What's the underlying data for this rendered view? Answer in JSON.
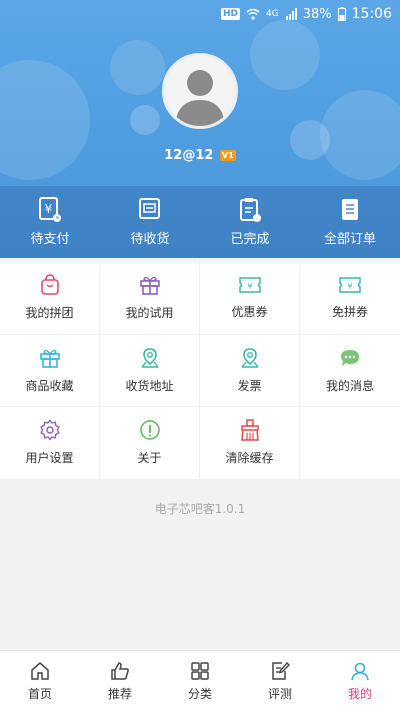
{
  "status_bar": {
    "hd": "HD",
    "network": "4G",
    "battery": "38%",
    "time": "15:06"
  },
  "profile": {
    "username": "12@12",
    "level_badge": "V1",
    "avatar_icon": "person-avatar-icon"
  },
  "orders": [
    {
      "label": "待支付",
      "icon": "pending-payment-icon"
    },
    {
      "label": "待收货",
      "icon": "pending-receipt-icon"
    },
    {
      "label": "已完成",
      "icon": "completed-order-icon"
    },
    {
      "label": "全部订单",
      "icon": "all-orders-icon"
    }
  ],
  "menu": [
    {
      "label": "我的拼团",
      "icon": "shopping-bag-icon",
      "color": "#e74c6f"
    },
    {
      "label": "我的试用",
      "icon": "gift-icon",
      "color": "#8e5ec9"
    },
    {
      "label": "优惠券",
      "icon": "ticket-icon",
      "color": "#3bb7a8"
    },
    {
      "label": "免拼券",
      "icon": "ticket-icon",
      "color": "#3bb7a8"
    },
    {
      "label": "商品收藏",
      "icon": "gift-icon",
      "color": "#3cb6d8"
    },
    {
      "label": "收货地址",
      "icon": "map-pin-icon",
      "color": "#3bb7a8"
    },
    {
      "label": "发票",
      "icon": "map-pin-icon",
      "color": "#3bb7a8"
    },
    {
      "label": "我的消息",
      "icon": "chat-bubble-icon",
      "color": "#5cb85c"
    },
    {
      "label": "用户设置",
      "icon": "gear-icon",
      "color": "#8e5ec9"
    },
    {
      "label": "关于",
      "icon": "info-icon",
      "color": "#5cb85c"
    },
    {
      "label": "清除缓存",
      "icon": "broom-icon",
      "color": "#e74c4c"
    }
  ],
  "version": "电子芯吧客1.0.1",
  "bottom_nav": [
    {
      "label": "首页",
      "icon": "home-icon"
    },
    {
      "label": "推荐",
      "icon": "thumbs-up-icon"
    },
    {
      "label": "分类",
      "icon": "grid-icon"
    },
    {
      "label": "评测",
      "icon": "edit-note-icon"
    },
    {
      "label": "我的",
      "icon": "user-icon",
      "active": true
    }
  ],
  "colors": {
    "header_blue": "#4f9de0",
    "active_pink": "#e4397a"
  }
}
